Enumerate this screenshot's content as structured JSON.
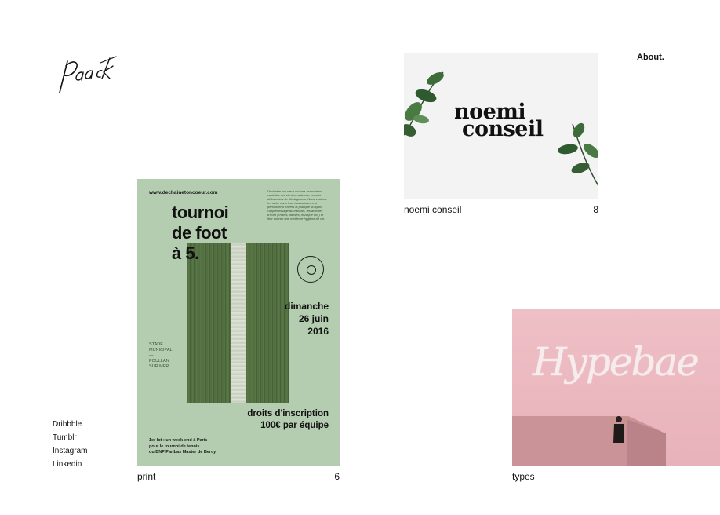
{
  "brand": {
    "logo_text": "Paack"
  },
  "nav": {
    "about": "About."
  },
  "social": [
    "Dribbble",
    "Tumblr",
    "Instagram",
    "Linkedin"
  ],
  "projects": [
    {
      "title": "noemi conseil",
      "count": "8",
      "image_text": [
        "noemi",
        "conseil"
      ]
    },
    {
      "title": "print",
      "count": "6",
      "poster": {
        "url": "www.dechainetoncoeur.com",
        "blurb": "Déchaine ton cœur est une association caritative qui vient en aide aux enfants défavorisés de Madagascar. Nous voulons les aider dans leur épanouissement personnel à travers la pratique du sport, l'apprentissage du français, les activités d'éveil (chants, danses, musique etc.) et leur donner une meilleure hygiène de vie.",
        "title_lines": [
          "tournoi",
          "de foot",
          "à 5."
        ],
        "badge": "ON COMPTE SUR VOUS",
        "date_lines": [
          "dimanche",
          "26 juin",
          "2016"
        ],
        "venue_lines": [
          "STADE",
          "MUNICIPAL",
          "—",
          "POULLAN",
          "SUR MER"
        ],
        "fee_lines": [
          "droits d'inscription",
          "100€ par équipe"
        ],
        "prize_lines": [
          "1er lot : un week-end à Paris",
          "pour le tournoi de tennis",
          "du BNP Paribas Master de Bercy."
        ]
      }
    },
    {
      "title": "types",
      "count": "",
      "image_text": "Hypebae"
    }
  ],
  "colors": {
    "poster_bg": "#b4cdb0",
    "types_bg": "#ebb8bf",
    "noemi_bg": "#f3f3f3"
  }
}
